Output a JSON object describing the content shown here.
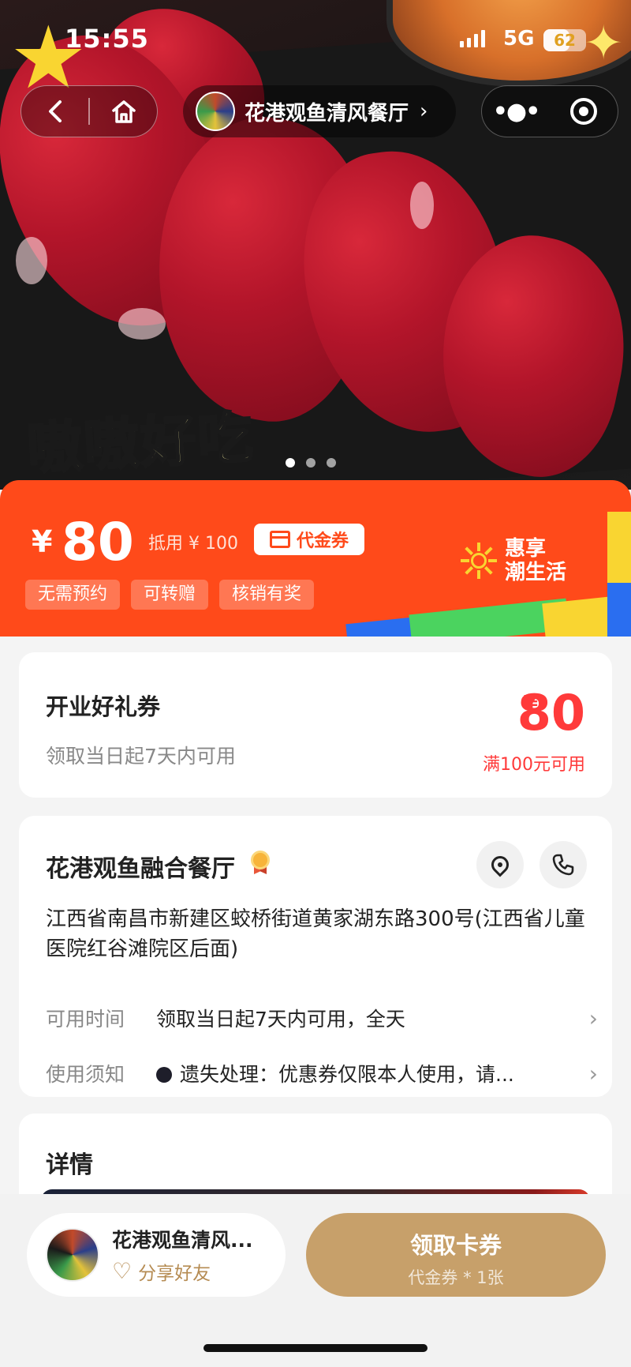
{
  "status_bar": {
    "time": "15:55",
    "network": "5G",
    "battery": "62",
    "battery_level": 0.62
  },
  "nav": {
    "back_icon": "chevron-left-icon",
    "home_icon": "home-icon",
    "store_name": "花港观鱼清风餐厅",
    "store_chevron": "›",
    "more_icon": "more-dots-icon",
    "close_icon": "target-icon"
  },
  "hero": {
    "overlay_text": "嗷嗷好吃",
    "carousel_count": 3,
    "carousel_active": 0
  },
  "price_banner": {
    "currency": "¥",
    "price": "80",
    "deduct_text": "抵用 ¥ 100",
    "voucher_tag": "代金券",
    "tags": [
      "无需预约",
      "可转赠",
      "核销有奖"
    ],
    "slogan_line1": "惠享",
    "slogan_line2": "潮生活",
    "colors": {
      "background": "#ff4a1a",
      "accent_blue": "#2a6ef0",
      "accent_green": "#4bd35f",
      "accent_yellow": "#f9d531"
    }
  },
  "coupon": {
    "name": "开业好礼券",
    "validity": "领取当日起7天内可用",
    "currency": "¥",
    "amount": "80",
    "condition": "满100元可用"
  },
  "store": {
    "name": "花港观鱼融合餐厅",
    "badge_icon": "medal-icon",
    "address": "江西省南昌市新建区蛟桥街道黄家湖东路300号(江西省儿童医院红谷滩院区后面)",
    "rows": [
      {
        "label": "可用时间",
        "value": "领取当日起7天内可用，全天"
      },
      {
        "label": "使用须知",
        "value": "遗失处理：优惠券仅限本人使用，请..."
      }
    ]
  },
  "detail": {
    "title": "详情"
  },
  "bottom": {
    "store_name": "花港观鱼清风...",
    "share_label": "分享好友",
    "claim_label": "领取卡券",
    "claim_sub": "代金券 * 1张",
    "colors": {
      "claim_bg": "#c7a06a",
      "share_text": "#b58b52"
    }
  }
}
